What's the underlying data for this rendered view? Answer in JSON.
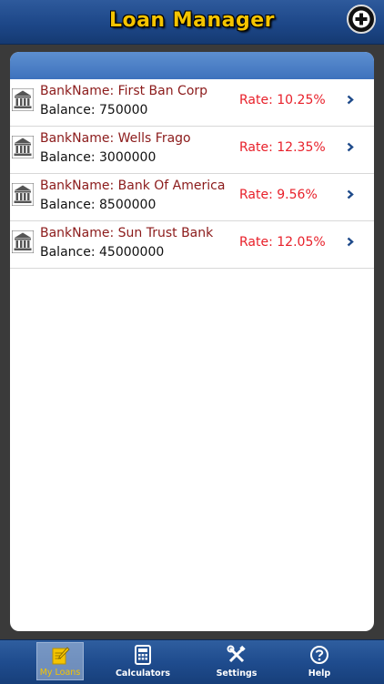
{
  "header": {
    "title": "Loan Manager",
    "add_icon": "plus-circle-icon"
  },
  "loans": [
    {
      "bank": "BankName: First Ban Corp",
      "balance": "Balance: 750000",
      "rate": "Rate: 10.25%"
    },
    {
      "bank": "BankName: Wells Frago",
      "balance": "Balance: 3000000",
      "rate": "Rate: 12.35%"
    },
    {
      "bank": "BankName: Bank Of America",
      "balance": "Balance: 8500000",
      "rate": "Rate: 9.56%"
    },
    {
      "bank": "BankName: Sun Trust Bank",
      "balance": "Balance: 45000000",
      "rate": "Rate: 12.05%"
    }
  ],
  "tabs": [
    {
      "label": "My Loans",
      "icon": "notepad-pencil-icon",
      "active": true
    },
    {
      "label": "Calculators",
      "icon": "calculator-icon",
      "active": false
    },
    {
      "label": "Settings",
      "icon": "tools-icon",
      "active": false
    },
    {
      "label": "Help",
      "icon": "help-circle-icon",
      "active": false
    }
  ],
  "colors": {
    "title": "#f5c400",
    "bank_name": "#8b1a1a",
    "rate": "#e8202a",
    "nav_blue": "#1d4788"
  }
}
